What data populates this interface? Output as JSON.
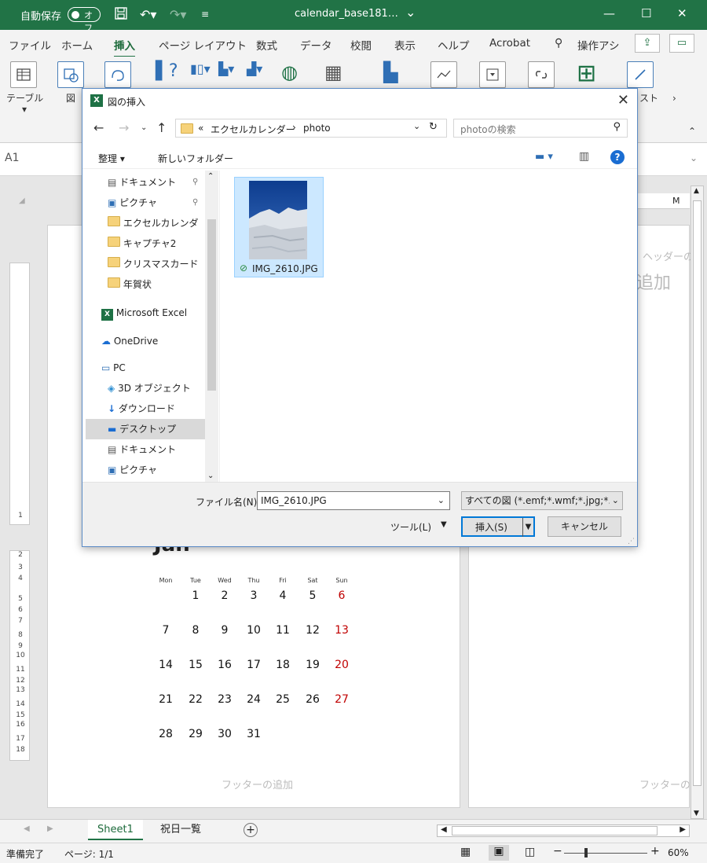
{
  "titlebar": {
    "autosave_label": "自動保存",
    "toggle_label": "オフ",
    "document_title": "calendar_base181…",
    "dropdown_arrow": "⌄"
  },
  "ribbon": {
    "tabs": [
      "ファイル",
      "ホーム",
      "挿入",
      "ページ レイアウト",
      "数式",
      "データ",
      "校閲",
      "表示",
      "ヘルプ",
      "Acrobat"
    ],
    "search_label": "操作アシ",
    "table_label": "テーブル",
    "illust_label": "図",
    "text_label": "スト"
  },
  "formula_bar": {
    "name_box": "A1"
  },
  "sheet": {
    "column_label": "M",
    "header_add": "ヘッダーの追",
    "header_add_big": "追加",
    "footer_add": "フッターの追加",
    "footer_add_right": "フッターの追",
    "month_fragment": "Jan",
    "row_numbers": [
      "1",
      "2",
      "3",
      "4",
      "5",
      "6",
      "7",
      "8",
      "9",
      "10",
      "11",
      "12",
      "13",
      "14",
      "15",
      "16",
      "17",
      "18"
    ],
    "weekdays": [
      "Mon",
      "Tue",
      "Wed",
      "Thu",
      "Fri",
      "Sat",
      "Sun"
    ],
    "weeks": [
      [
        "",
        "1",
        "2",
        "3",
        "4",
        "5",
        "6"
      ],
      [
        "7",
        "8",
        "9",
        "10",
        "11",
        "12",
        "13"
      ],
      [
        "14",
        "15",
        "16",
        "17",
        "18",
        "19",
        "20"
      ],
      [
        "21",
        "22",
        "23",
        "24",
        "25",
        "26",
        "27"
      ],
      [
        "28",
        "29",
        "30",
        "31",
        "",
        "",
        ""
      ]
    ],
    "sunday_color": "#c00000"
  },
  "sheet_tabs": {
    "tabs": [
      "Sheet1",
      "祝日一覧"
    ],
    "add": "+"
  },
  "status_bar": {
    "ready": "準備完了",
    "page": "ページ: 1/1",
    "zoom": "60%"
  },
  "dialog": {
    "title": "図の挿入",
    "breadcrumb": [
      "«",
      "エクセルカレンダー",
      "›",
      "photo"
    ],
    "search_placeholder": "photoの検索",
    "organize": "整理 ▾",
    "new_folder": "新しいフォルダー",
    "nav_items": [
      {
        "label": "ドキュメント",
        "icon": "document-icon",
        "pinned": true
      },
      {
        "label": "ピクチャ",
        "icon": "pictures-icon",
        "pinned": true
      },
      {
        "label": "エクセルカレンダー",
        "icon": "folder-icon"
      },
      {
        "label": "キャプチャ2",
        "icon": "folder-icon"
      },
      {
        "label": "クリスマスカード",
        "icon": "folder-icon"
      },
      {
        "label": "年賀状",
        "icon": "folder-icon"
      },
      {
        "label": "Microsoft Excel",
        "icon": "excel-icon"
      },
      {
        "label": "OneDrive",
        "icon": "onedrive-icon"
      },
      {
        "label": "PC",
        "icon": "pc-icon"
      },
      {
        "label": "3D オブジェクト",
        "icon": "3d-objects-icon"
      },
      {
        "label": "ダウンロード",
        "icon": "download-icon"
      },
      {
        "label": "デスクトップ",
        "icon": "desktop-icon",
        "selected": true
      },
      {
        "label": "ドキュメント",
        "icon": "document-icon"
      },
      {
        "label": "ピクチャ",
        "icon": "pictures-icon"
      }
    ],
    "file": {
      "name": "IMG_2610.JPG"
    },
    "filename_label": "ファイル名(N):",
    "filename_value": "IMG_2610.JPG",
    "filetype_value": "すべての図 (*.emf;*.wmf;*.jpg;*.j",
    "tools_label": "ツール(L)",
    "insert_label": "挿入(S)",
    "cancel_label": "キャンセル"
  }
}
